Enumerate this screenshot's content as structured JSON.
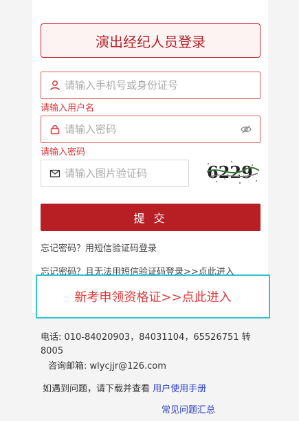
{
  "login": {
    "title": "演出经纪人员登录",
    "username_placeholder": "请输入手机号或身份证号",
    "username_error": "请输入用户名",
    "password_placeholder": "请输入密码",
    "password_error": "请输入密码",
    "captcha_placeholder": "请输入图片验证码",
    "captcha_text": "6229",
    "submit_label": "提 交"
  },
  "links": {
    "sms_login": "忘记密码？用短信验证码登录",
    "no_sms": "忘记密码？且无法用短信验证码登录>>点此进入",
    "new_exam": "新考申领资格证>>点此进入"
  },
  "contact": {
    "phone_line1": "电话: 010-84020903，84031104，65526751 转",
    "phone_line2": "8005",
    "email": "咨询邮箱: wlycjjr@126.com",
    "manual_prefix": "如遇到问题，请下载并查看",
    "manual_link": "用户使用手册",
    "faq_link": "常见问题汇总"
  },
  "colors": {
    "brand_red": "#b71f24",
    "error_red": "#d8343a",
    "highlight_cyan": "#2ec4d0",
    "link_blue": "#2a3fc9"
  },
  "icons": {
    "username": "user-icon",
    "password": "lock-icon",
    "captcha": "mail-icon",
    "visibility": "eye-off-icon"
  }
}
